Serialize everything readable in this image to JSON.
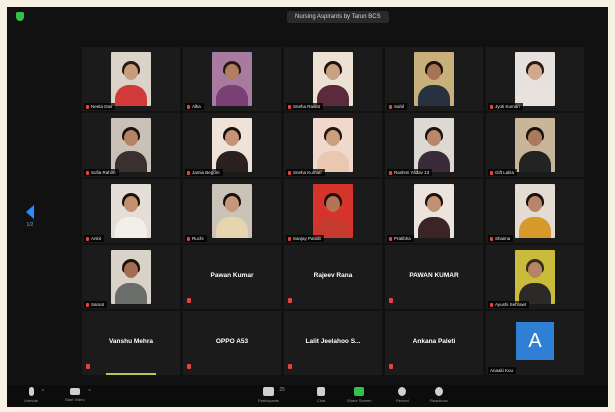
{
  "window": {
    "speaker_title": "Nursing Aspirants by Tarun BCS"
  },
  "pagination": {
    "current": "1/2"
  },
  "participants": [
    {
      "type": "video",
      "name": "Neeta Das",
      "skin": "#c89c7c",
      "hair": "#2a1a12",
      "shirt": "#d23a3a",
      "bg": "#d9d3c8"
    },
    {
      "type": "video",
      "name": "Alka",
      "skin": "#b27e62",
      "hair": "#2b1a12",
      "shirt": "#7a3f74",
      "bg": "#a97aa0"
    },
    {
      "type": "video",
      "name": "Sneha Rawat",
      "skin": "#c9a183",
      "hair": "#1e130d",
      "shirt": "#5b2b3b",
      "bg": "#ede1d4"
    },
    {
      "type": "video",
      "name": "Sahil",
      "skin": "#a57455",
      "hair": "#1e130d",
      "shirt": "#27313f",
      "bg": "#c8b07a"
    },
    {
      "type": "video",
      "name": "Jyoti Kumari",
      "skin": "#d1a88c",
      "hair": "#2a1b12",
      "shirt": "#e9e2dc",
      "bg": "#e6e1dd"
    },
    {
      "type": "video",
      "name": "Sofia Rahim",
      "skin": "#b38466",
      "hair": "#1e120b",
      "shirt": "#3a3030",
      "bg": "#c9c1b8"
    },
    {
      "type": "video",
      "name": "Jamia Begum",
      "skin": "#c79377",
      "hair": "#1a100b",
      "shirt": "#2b2020",
      "bg": "#efe2d8"
    },
    {
      "type": "video",
      "name": "Sneha Kumari",
      "skin": "#c99f7e",
      "hair": "#24160f",
      "shirt": "#eac8b0",
      "bg": "#f0d9cc"
    },
    {
      "type": "video",
      "name": "Rashmi Yadav 13",
      "skin": "#b9876a",
      "hair": "#1d120c",
      "shirt": "#3a2b38",
      "bg": "#ddd8d2"
    },
    {
      "type": "video",
      "name": "Gift Lalita",
      "skin": "#ab7a5c",
      "hair": "#1d120b",
      "shirt": "#232323",
      "bg": "#c9b59a"
    },
    {
      "type": "video",
      "name": "Ankit",
      "skin": "#c48f6e",
      "hair": "#1b110b",
      "shirt": "#f2efe9",
      "bg": "#e3ded6"
    },
    {
      "type": "video",
      "name": "Ruchi",
      "skin": "#c59679",
      "hair": "#1a0f0a",
      "shirt": "#e7d5b0",
      "bg": "#ccc3b8"
    },
    {
      "type": "video",
      "name": "Sanjay Pandit",
      "skin": "#b77454",
      "hair": "#1a100b",
      "shirt": "#c43a2e",
      "bg": "#d6332a"
    },
    {
      "type": "video",
      "name": "Pratibha",
      "skin": "#c09173",
      "hair": "#1b110b",
      "shirt": "#3a2426",
      "bg": "#ece4dc"
    },
    {
      "type": "video",
      "name": "Shaima",
      "skin": "#b7866a",
      "hair": "#1a100a",
      "shirt": "#d59a2a",
      "bg": "#e4dbd2"
    },
    {
      "type": "video",
      "name": "Samat",
      "skin": "#a46d52",
      "hair": "#1c120c",
      "shirt": "#6b6d6a",
      "bg": "#d8d2c8"
    },
    {
      "type": "name",
      "name": "Pawan Kumar"
    },
    {
      "type": "name",
      "name": "Rajeev Rana"
    },
    {
      "type": "name",
      "name": "PAWAN KUMAR"
    },
    {
      "type": "video",
      "name": "Ayushi Sehrawt",
      "skin": "#b58566",
      "hair": "#3a2a1a",
      "shirt": "#2c2a28",
      "bg": "#c9bc3b"
    },
    {
      "type": "name",
      "name": "Vanshu Mehra"
    },
    {
      "type": "name",
      "name": "OPPO A53"
    },
    {
      "type": "name",
      "name": "Lalit Jeelahoo S..."
    },
    {
      "type": "name",
      "name": "Ankana Paleti"
    },
    {
      "type": "avatar",
      "name": "Anaaki Kuu",
      "initial": "A"
    }
  ],
  "toolbar": {
    "unmute": "Unmute",
    "start_video": "Start Video",
    "participants": "Participants",
    "participants_count": "25",
    "chat": "Chat",
    "share_screen": "Share Screen",
    "record": "Record",
    "reactions": "Reactions"
  }
}
